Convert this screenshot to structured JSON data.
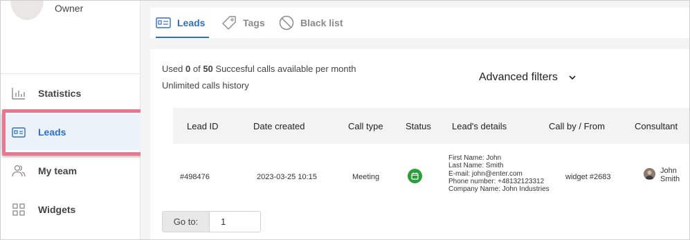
{
  "profile": {
    "role": "Owner"
  },
  "sidebar": {
    "items": [
      {
        "label": "Statistics",
        "icon": "bar-chart-icon"
      },
      {
        "label": "Leads",
        "icon": "contact-card-icon",
        "active": true
      },
      {
        "label": "My team",
        "icon": "team-icon"
      },
      {
        "label": "Widgets",
        "icon": "widgets-grid-icon"
      }
    ]
  },
  "tabs": [
    {
      "label": "Leads",
      "icon": "contact-card-icon",
      "active": true
    },
    {
      "label": "Tags",
      "icon": "tag-icon"
    },
    {
      "label": "Black list",
      "icon": "block-icon"
    }
  ],
  "usage": {
    "prefix": "Used",
    "used": "0",
    "of": "of",
    "limit": "50",
    "suffix": "Succesful calls available per month",
    "history": "Unlimited calls history"
  },
  "filters": {
    "label": "Advanced filters"
  },
  "table": {
    "headers": {
      "lead_id": "Lead ID",
      "date_created": "Date created",
      "call_type": "Call type",
      "status": "Status",
      "details": "Lead's details",
      "call_by": "Call by / From",
      "consultant": "Consultant"
    },
    "rows": [
      {
        "lead_id": "#498476",
        "date_created": "2023-03-25 10:15",
        "call_type": "Meeting",
        "status_icon": "calendar-status-icon",
        "details": {
          "first_name": "First Name: John",
          "last_name": "Last Name: Smith",
          "email": "E-mail: john@enter.com",
          "phone": "Phone number: +48132123312",
          "company": "Company Name: John Industries"
        },
        "call_by": "widget #2683",
        "consultant": {
          "first": "John",
          "last": "Smith"
        }
      }
    ]
  },
  "pagination": {
    "goto_label": "Go to:",
    "page_value": "1"
  },
  "colors": {
    "accent": "#2f6ec7",
    "status_green": "#2c9d3a",
    "highlight": "#e8778f"
  }
}
